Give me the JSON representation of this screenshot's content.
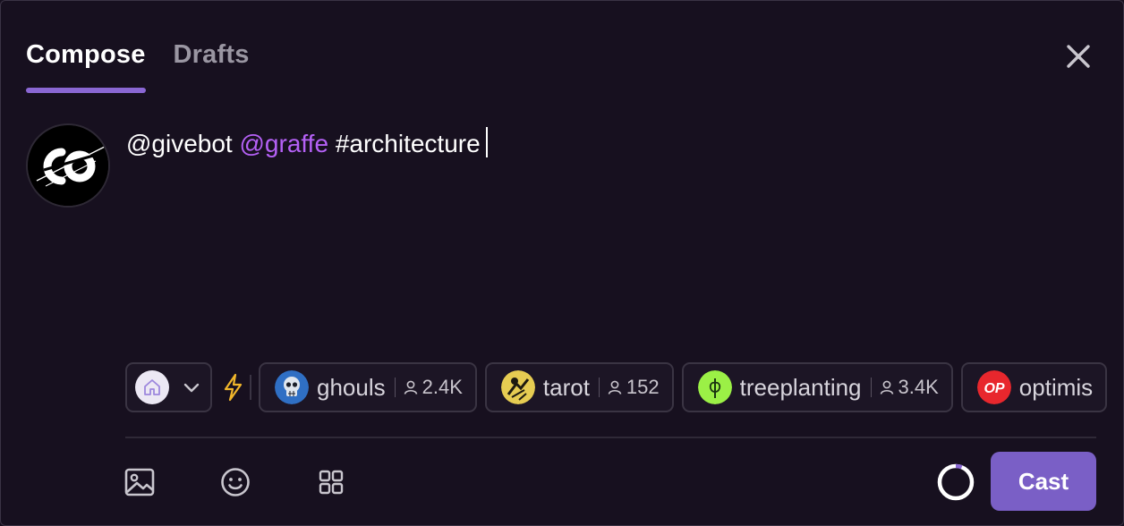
{
  "tabs": [
    {
      "label": "Compose",
      "active": true
    },
    {
      "label": "Drafts",
      "active": false
    }
  ],
  "editor": {
    "mention_1": "@givebot",
    "mention_2": "@graffe",
    "hashtag": "#architecture"
  },
  "avatar": {
    "logo_text": "CO"
  },
  "channel_selector": {
    "icon": "home-icon",
    "dropdown_icon": "chevron-down-icon"
  },
  "channels": [
    {
      "name": "ghouls",
      "members": "2.4K"
    },
    {
      "name": "tarot",
      "members": "152"
    },
    {
      "name": "treeplanting",
      "members": "3.4K"
    },
    {
      "name": "optimis",
      "badge": "OP"
    }
  ],
  "toolbar": {
    "icons": [
      "image-icon",
      "emoji-icon",
      "apps-grid-icon"
    ],
    "cast_label": "Cast"
  },
  "character_progress": 0.06,
  "colors": {
    "background": "#17101f",
    "accent": "#8a67d3",
    "cast_button": "#7a5fc6",
    "mention_accent": "#b561f6"
  }
}
